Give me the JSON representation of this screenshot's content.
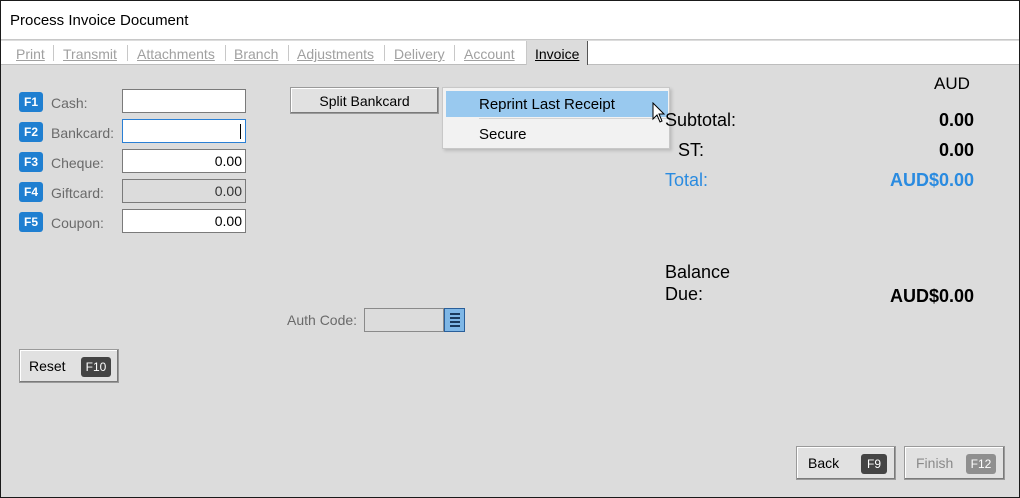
{
  "window": {
    "title": "Process Invoice Document"
  },
  "tabs": [
    {
      "label": "Print",
      "active": false
    },
    {
      "label": "Transmit",
      "active": false
    },
    {
      "label": "Attachments",
      "active": false
    },
    {
      "label": "Branch",
      "active": false
    },
    {
      "label": "Adjustments",
      "active": false
    },
    {
      "label": "Delivery",
      "active": false
    },
    {
      "label": "Account",
      "active": false
    },
    {
      "label": "Invoice",
      "active": true
    }
  ],
  "payments": [
    {
      "key": "F1",
      "label": "Cash:",
      "value": ""
    },
    {
      "key": "F2",
      "label": "Bankcard:",
      "value": ""
    },
    {
      "key": "F3",
      "label": "Cheque:",
      "value": "0.00"
    },
    {
      "key": "F4",
      "label": "Giftcard:",
      "value": "0.00"
    },
    {
      "key": "F5",
      "label": "Coupon:",
      "value": "0.00"
    }
  ],
  "split_bankcard": {
    "label": "Split Bankcard"
  },
  "dropdown_menu": {
    "items": [
      {
        "label": "Reprint Last Receipt",
        "highlighted": true
      },
      {
        "label": "Secure",
        "highlighted": false
      }
    ]
  },
  "auth": {
    "label": "Auth Code:",
    "value": ""
  },
  "reset": {
    "label": "Reset",
    "key": "F10"
  },
  "summary": {
    "currency": "AUD",
    "subtotal_label": "Subtotal:",
    "subtotal_value": "0.00",
    "st_label": "ST:",
    "st_value": "0.00",
    "total_label": "Total:",
    "total_value": "AUD$0.00",
    "balance_label_line1": "Balance",
    "balance_label_line2": "Due:",
    "balance_value": "AUD$0.00"
  },
  "footer": {
    "back_label": "Back",
    "back_key": "F9",
    "finish_label": "Finish",
    "finish_key": "F12"
  },
  "colors": {
    "accent": "#2a8be0",
    "fkey": "#1f7fd1",
    "menu_highlight": "#99c9ef"
  }
}
